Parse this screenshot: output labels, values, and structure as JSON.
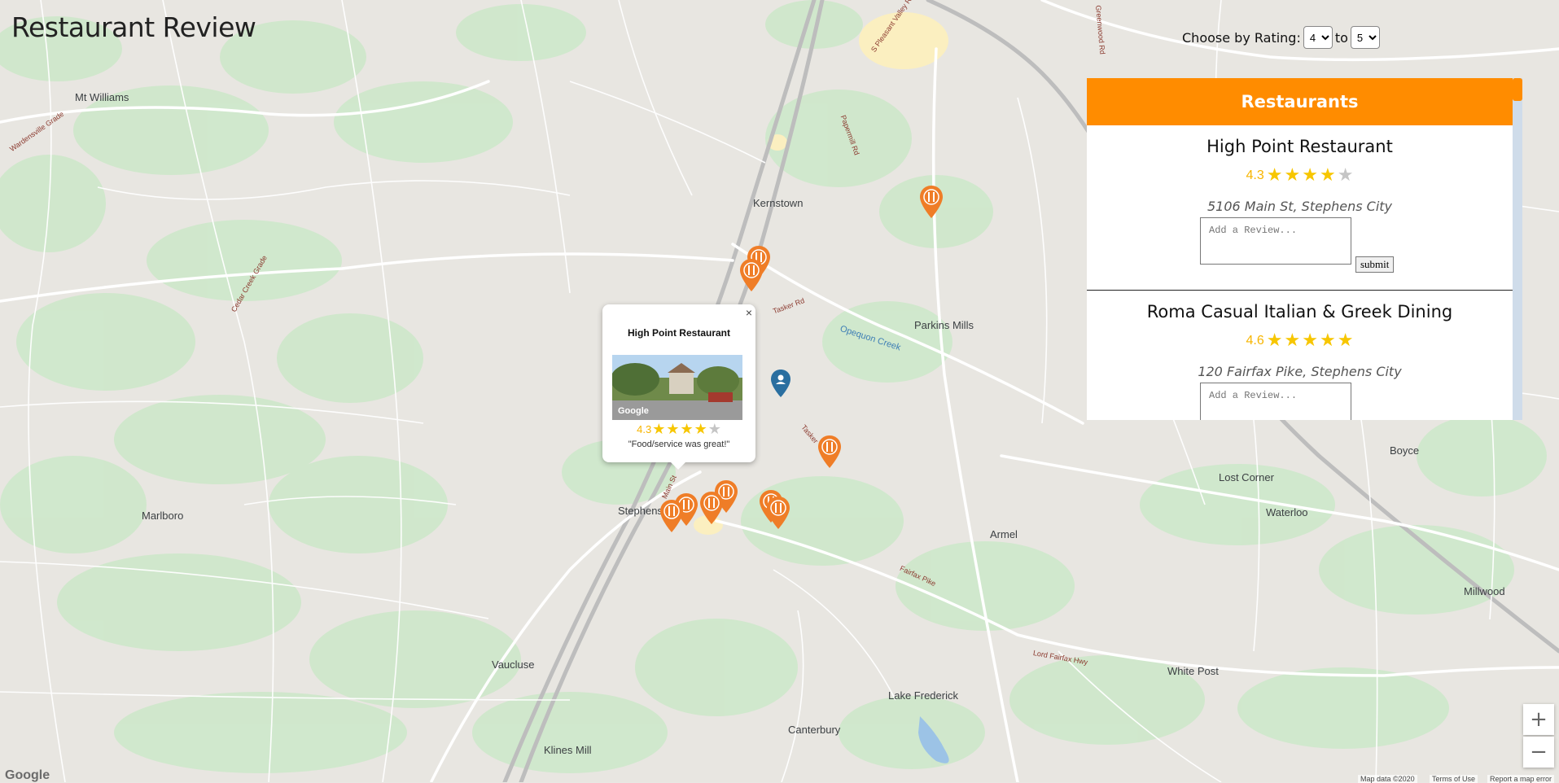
{
  "app": {
    "title": "Restaurant Review"
  },
  "filter": {
    "label": "Choose by Rating:",
    "from_value": "4",
    "to_label": "to",
    "to_value": "5"
  },
  "panel": {
    "header": "Restaurants",
    "review_placeholder": "Add a Review...",
    "submit_label": "submit",
    "restaurants": [
      {
        "name": "High Point Restaurant",
        "rating": "4.3",
        "stars": 4,
        "address": "5106 Main St, Stephens City"
      },
      {
        "name": "Roma Casual Italian & Greek Dining",
        "rating": "4.6",
        "stars": 5,
        "address": "120 Fairfax Pike, Stephens City"
      }
    ]
  },
  "info_window": {
    "name": "High Point Restaurant",
    "rating": "4.3",
    "stars": 4,
    "quote": "\"Food/service was great!\"",
    "photo_credit": "Google",
    "close_label": "×"
  },
  "map": {
    "places": [
      "Mt Williams",
      "Kernstown",
      "Parkins Mills",
      "Marlboro",
      "Stephens",
      "Lost Corner",
      "Boyce",
      "Waterloo",
      "Armel",
      "Millwood",
      "Vaucluse",
      "White Post",
      "Lake Frederick",
      "Canterbury",
      "Klines Mill"
    ],
    "roads": [
      "Wardensville Grade",
      "Cedar Creek Grade",
      "S Pleasant Valley Rd",
      "Greenwood Rd",
      "Papermill Rd",
      "Tasker Rd",
      "Main St",
      "Fairfax Pike",
      "Lord Fairfax Hwy",
      "Tasker"
    ],
    "water": [
      "Opequon Creek"
    ],
    "zoom_in": "+",
    "zoom_out": "−",
    "logo": "Google",
    "attribution": [
      "Map data ©2020",
      "Terms of Use",
      "Report a map error"
    ]
  },
  "colors": {
    "accent": "#ff8c00",
    "star": "#f7c600",
    "marker": "#ef7d27",
    "user_marker": "#2a6fa0"
  }
}
